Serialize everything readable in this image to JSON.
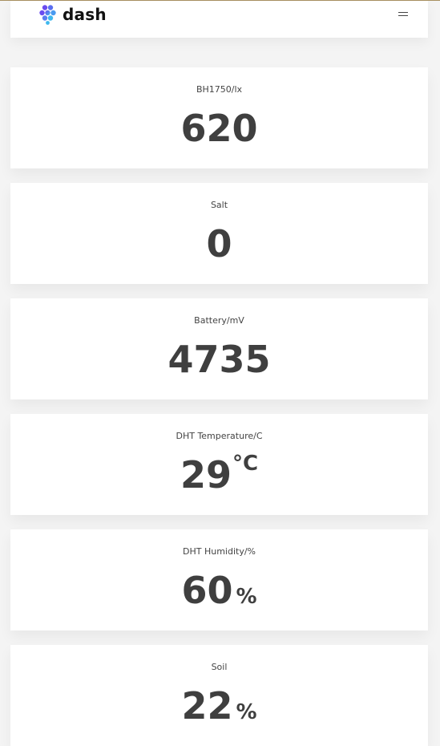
{
  "header": {
    "logo_text": "dash",
    "menu_icon": "hamburger-menu-icon"
  },
  "cards": [
    {
      "label": "BH1750/lx",
      "value": "620",
      "unit": ""
    },
    {
      "label": "Salt",
      "value": "0",
      "unit": ""
    },
    {
      "label": "Battery/mV",
      "value": "4735",
      "unit": ""
    },
    {
      "label": "DHT Temperature/C",
      "value": "29",
      "unit": "°C"
    },
    {
      "label": "DHT Humidity/%",
      "value": "60",
      "unit": "%"
    },
    {
      "label": "Soil",
      "value": "22",
      "unit": "%"
    }
  ],
  "colors": {
    "page_bg": "#f4f4f4",
    "card_bg": "#ffffff",
    "value_text": "#3f3f3f",
    "logo_gradient_start": "#6a4cf0",
    "logo_gradient_end": "#3fb8ee"
  }
}
